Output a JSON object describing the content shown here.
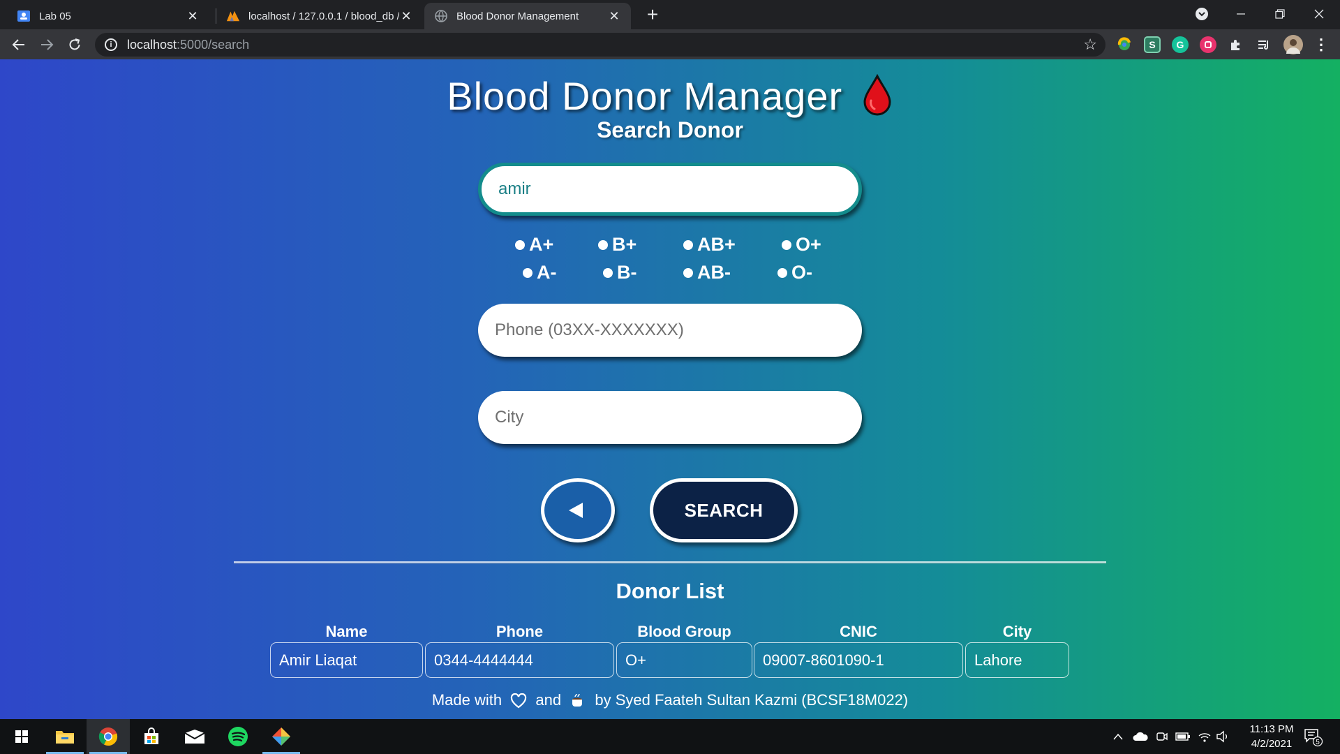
{
  "browser": {
    "tabs": [
      {
        "title": "Lab 05",
        "icon": "classroom-icon"
      },
      {
        "title": "localhost / 127.0.0.1 / blood_db / ",
        "icon": "phpmyadmin-icon"
      },
      {
        "title": "Blood Donor Management",
        "icon": "globe-icon",
        "active": true
      }
    ],
    "url_host": "localhost",
    "url_path": ":5000/search"
  },
  "page": {
    "title": "Blood Donor Manager",
    "subtitle": "Search Donor",
    "search": {
      "name_value": "amir",
      "phone_placeholder": "Phone (03XX-XXXXXXX)",
      "city_placeholder": "City"
    },
    "blood_groups": [
      "A+",
      "B+",
      "AB+",
      "O+",
      "A-",
      "B-",
      "AB-",
      "O-"
    ],
    "search_button": "SEARCH",
    "donor_list_title": "Donor List",
    "table": {
      "headers": [
        "Name",
        "Phone",
        "Blood Group",
        "CNIC",
        "City"
      ],
      "rows": [
        [
          "Amir Liaqat",
          "0344-4444444",
          "O+",
          "09007-8601090-1",
          "Lahore"
        ]
      ]
    },
    "footer": {
      "made_with": "Made with",
      "and": "and",
      "by": "by Syed Faateh Sultan Kazmi (BCSF18M022)"
    },
    "colors": {
      "gradient_start": "#2e47c9",
      "gradient_end": "#14b062",
      "search_button_bg": "#0c2246",
      "drop_red": "#e0101a"
    }
  },
  "taskbar": {
    "time": "11:13 PM",
    "date": "4/2/2021",
    "notification_count": "5"
  }
}
